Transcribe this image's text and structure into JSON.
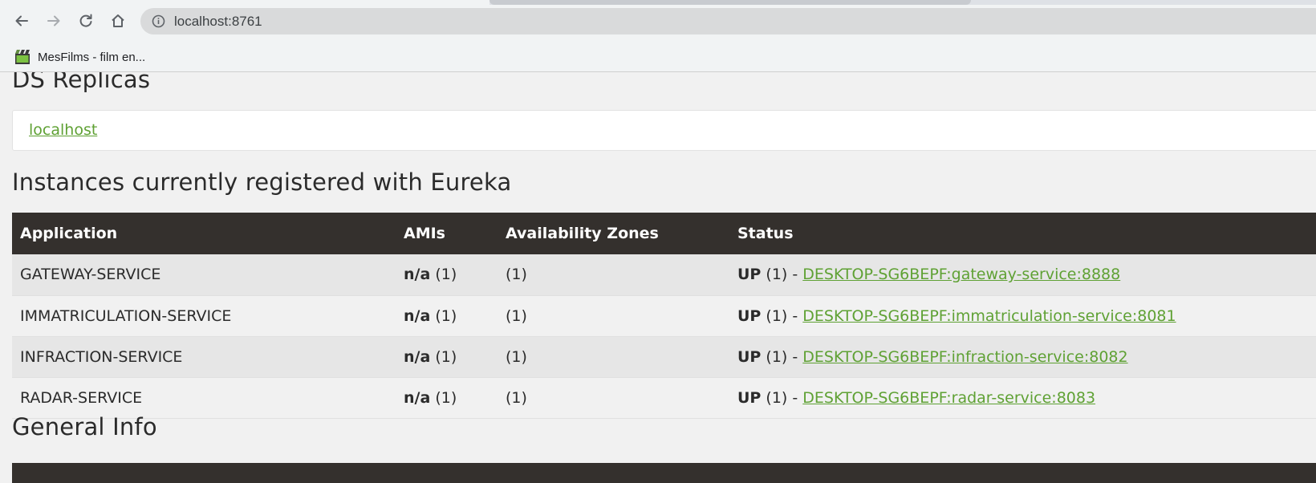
{
  "browser": {
    "url": "localhost:8761",
    "nav": {
      "back_icon": "arrow-left-icon",
      "forward_icon": "arrow-right-icon",
      "reload_icon": "reload-icon",
      "home_icon": "home-icon",
      "site_info_icon": "info-circle-icon"
    },
    "bookmarks": [
      {
        "label": "MesFilms - film en...",
        "icon": "film-clapper-icon"
      }
    ]
  },
  "page": {
    "ds_replicas": {
      "title": "DS Replicas",
      "items": [
        "localhost"
      ]
    },
    "instances": {
      "title": "Instances currently registered with Eureka",
      "columns": [
        "Application",
        "AMIs",
        "Availability Zones",
        "Status"
      ],
      "rows": [
        {
          "application": "GATEWAY-SERVICE",
          "amis_label": "n/a",
          "amis_count": "(1)",
          "zones": "(1)",
          "status": "UP",
          "status_count": "(1) -",
          "instance_link": "DESKTOP-SG6BEPF:gateway-service:8888"
        },
        {
          "application": "IMMATRICULATION-SERVICE",
          "amis_label": "n/a",
          "amis_count": "(1)",
          "zones": "(1)",
          "status": "UP",
          "status_count": "(1) -",
          "instance_link": "DESKTOP-SG6BEPF:immatriculation-service:8081"
        },
        {
          "application": "INFRACTION-SERVICE",
          "amis_label": "n/a",
          "amis_count": "(1)",
          "zones": "(1)",
          "status": "UP",
          "status_count": "(1) -",
          "instance_link": "DESKTOP-SG6BEPF:infraction-service:8082"
        },
        {
          "application": "RADAR-SERVICE",
          "amis_label": "n/a",
          "amis_count": "(1)",
          "zones": "(1)",
          "status": "UP",
          "status_count": "(1) -",
          "instance_link": "DESKTOP-SG6BEPF:radar-service:8083"
        }
      ]
    },
    "general_info": {
      "title": "General Info"
    }
  },
  "colors": {
    "link_green": "#5fa134",
    "table_header_bg": "#34302d",
    "page_bg": "#f1f1f1"
  }
}
